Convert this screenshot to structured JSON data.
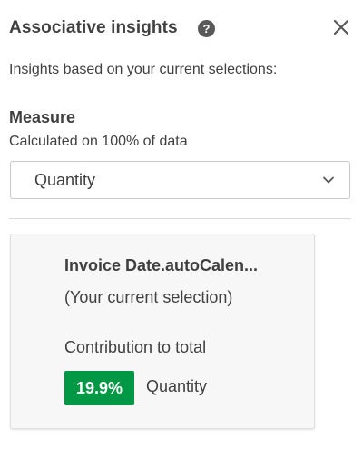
{
  "header": {
    "title": "Associative insights",
    "help_icon": "help-icon",
    "help_glyph": "?",
    "close_icon": "close-icon"
  },
  "subtitle": "Insights based on your current selections:",
  "measure": {
    "label": "Measure",
    "note": "Calculated on 100% of data",
    "selected": "Quantity",
    "dropdown_icon": "chevron-down-icon"
  },
  "insight_card": {
    "field": "Invoice Date.autoCalen...",
    "selection_note": "(Your current selection)",
    "contribution_label": "Contribution to total",
    "contribution_value": "19.9%",
    "contribution_measure": "Quantity",
    "badge_color": "#009845"
  }
}
